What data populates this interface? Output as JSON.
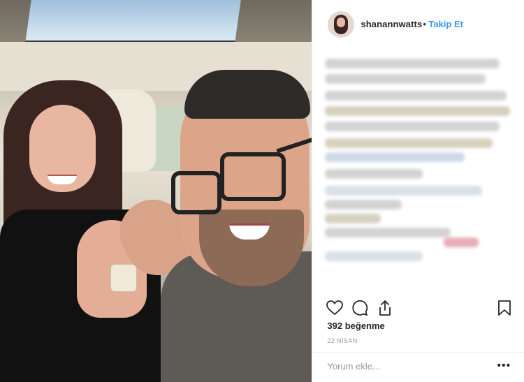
{
  "post": {
    "username": "shanannwatts",
    "separator": "•",
    "follow_label": "Takip Et",
    "likes_label": "392 beğenme",
    "date_label": "22 NİSAN",
    "comment_placeholder": "Yorum ekle...",
    "more_label": "•••"
  },
  "icons": {
    "like": "heart-icon",
    "comment": "comment-icon",
    "share": "share-icon",
    "save": "bookmark-icon"
  },
  "colors": {
    "link": "#3897f0",
    "text": "#262626",
    "muted": "#999999"
  }
}
